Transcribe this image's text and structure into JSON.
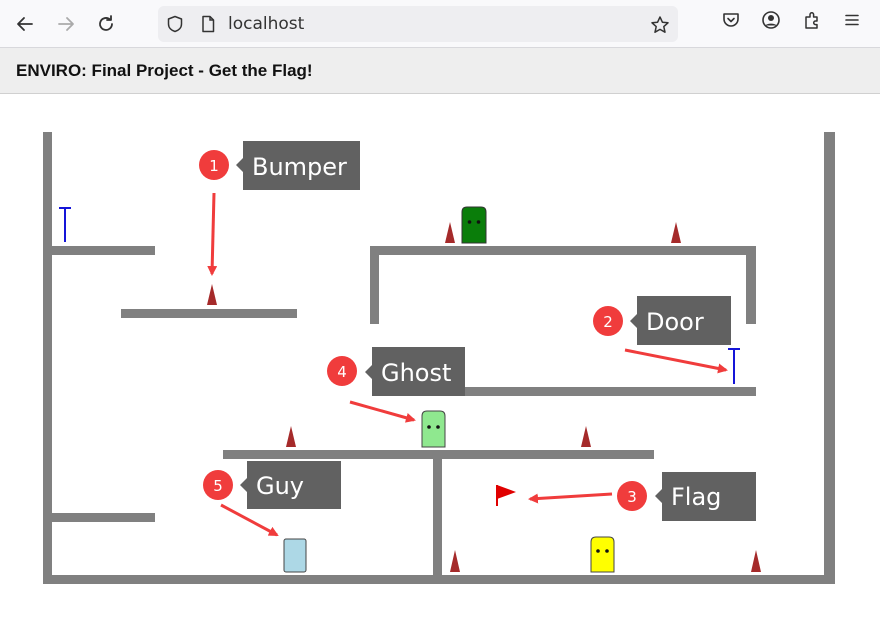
{
  "browser": {
    "url": "localhost",
    "icons": [
      "back-arrow-icon",
      "forward-arrow-icon",
      "reload-icon",
      "shield-icon",
      "page-icon",
      "star-icon",
      "pocket-icon",
      "account-icon",
      "extensions-icon",
      "menu-icon"
    ]
  },
  "page": {
    "title": "ENVIRO: Final Project - Get the Flag!"
  },
  "callouts": [
    {
      "number": "1",
      "label": "Bumper"
    },
    {
      "number": "2",
      "label": "Door"
    },
    {
      "number": "3",
      "label": "Flag"
    },
    {
      "number": "4",
      "label": "Ghost"
    },
    {
      "number": "5",
      "label": "Guy"
    }
  ],
  "colors": {
    "wall": "#808080",
    "bumper": "#a52a2a",
    "door": "#1515d8",
    "flag": "#e00000",
    "ghost_green_dark": "#0a7d0a",
    "ghost_green_light": "#8fe88f",
    "ghost_yellow": "#ffff00",
    "guy": "#add8e6",
    "callout_bg": "#616161",
    "callout_badge": "#f03c3c",
    "arrow": "#f03c3c"
  }
}
